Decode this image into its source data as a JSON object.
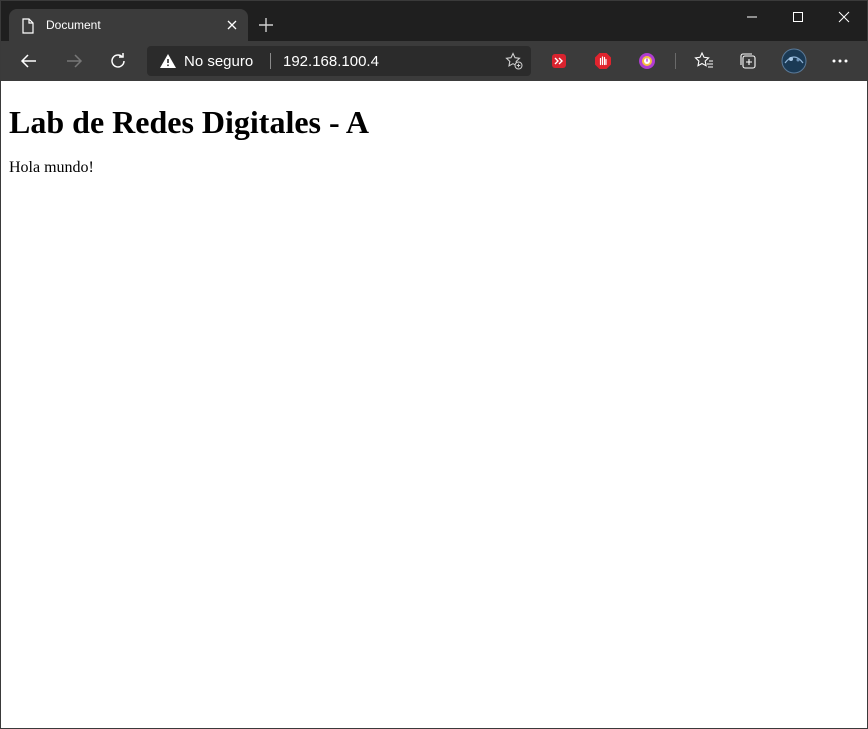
{
  "browser": {
    "tab": {
      "title": "Document"
    },
    "address_bar": {
      "security_text": "No seguro",
      "url": "192.168.100.4"
    },
    "icons": [
      "page-icon",
      "close-icon",
      "plus-icon",
      "minimize-icon",
      "maximize-icon",
      "close-window-icon",
      "back-arrow-icon",
      "forward-arrow-icon",
      "refresh-icon",
      "warning-icon",
      "add-favorite-icon",
      "extension-red-icon",
      "extension-hand-icon",
      "extension-purple-icon",
      "favorites-icon",
      "collections-icon",
      "profile-avatar",
      "more-icon"
    ],
    "colors": {
      "chrome_dark": "#1f1f1f",
      "toolbar": "#3b3b3b",
      "address_bg": "#2b2b2b",
      "page_bg": "#ffffff"
    }
  },
  "page": {
    "heading": "Lab de Redes Digitales - A",
    "paragraph": "Hola mundo!"
  }
}
